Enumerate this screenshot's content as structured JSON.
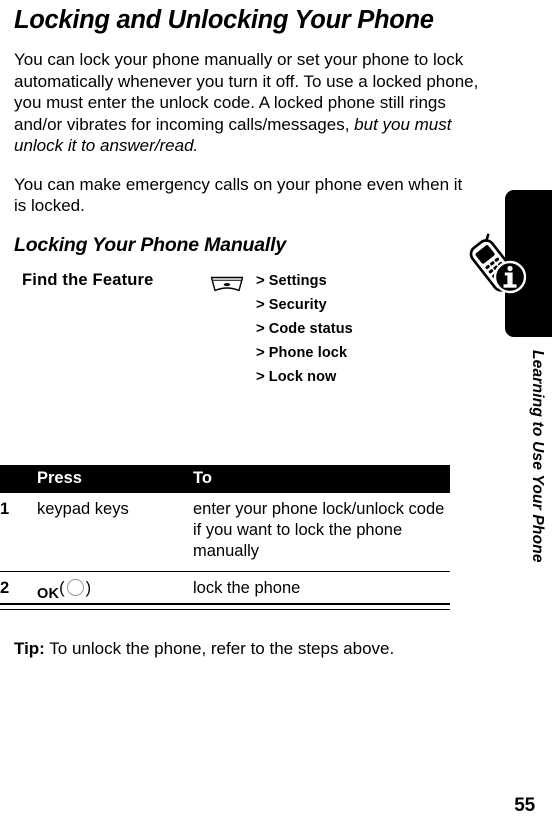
{
  "page": {
    "title": "Locking and Unlocking Your Phone",
    "number": "55"
  },
  "paragraphs": {
    "intro_part1": "You can lock your phone manually or set your phone to lock automatically whenever you turn it off. To use a locked phone, you must enter the unlock code. A locked phone still rings and/or vibrates for incoming calls/messages, ",
    "intro_italic": "but you must unlock it to answer/read.",
    "emergency": "You can make emergency calls on your phone even when it is locked."
  },
  "section": {
    "title": "Locking Your Phone Manually"
  },
  "find_the_feature": {
    "label": "Find the Feature",
    "menu_icon": "center-select-key-icon",
    "steps": [
      {
        "arrow": ">",
        "name": "Settings"
      },
      {
        "arrow": ">",
        "name": "Security"
      },
      {
        "arrow": ">",
        "name": "Code status"
      },
      {
        "arrow": ">",
        "name": "Phone lock"
      },
      {
        "arrow": ">",
        "name": "Lock now"
      }
    ]
  },
  "steps_table": {
    "headers": {
      "number": "",
      "press": "Press",
      "to": "To"
    },
    "rows": [
      {
        "number": "1",
        "press": "keypad keys",
        "to": "enter your phone lock/unlock code if you want to lock the phone manually"
      },
      {
        "number": "2",
        "press_key": "OK",
        "press_paren_open": "(",
        "press_paren_close": ")",
        "press_icon": "round-select-key-icon",
        "to": "lock the phone"
      }
    ]
  },
  "tip": {
    "label": "Tip:",
    "text": " To unlock the phone, refer to the steps above."
  },
  "sidebar": {
    "chapter_title": "Learning to Use Your Phone",
    "icon": "phone-with-info-icon"
  },
  "colors": {
    "ink": "#000000",
    "paper": "#ffffff",
    "key_outline": "#9a9a9a"
  }
}
